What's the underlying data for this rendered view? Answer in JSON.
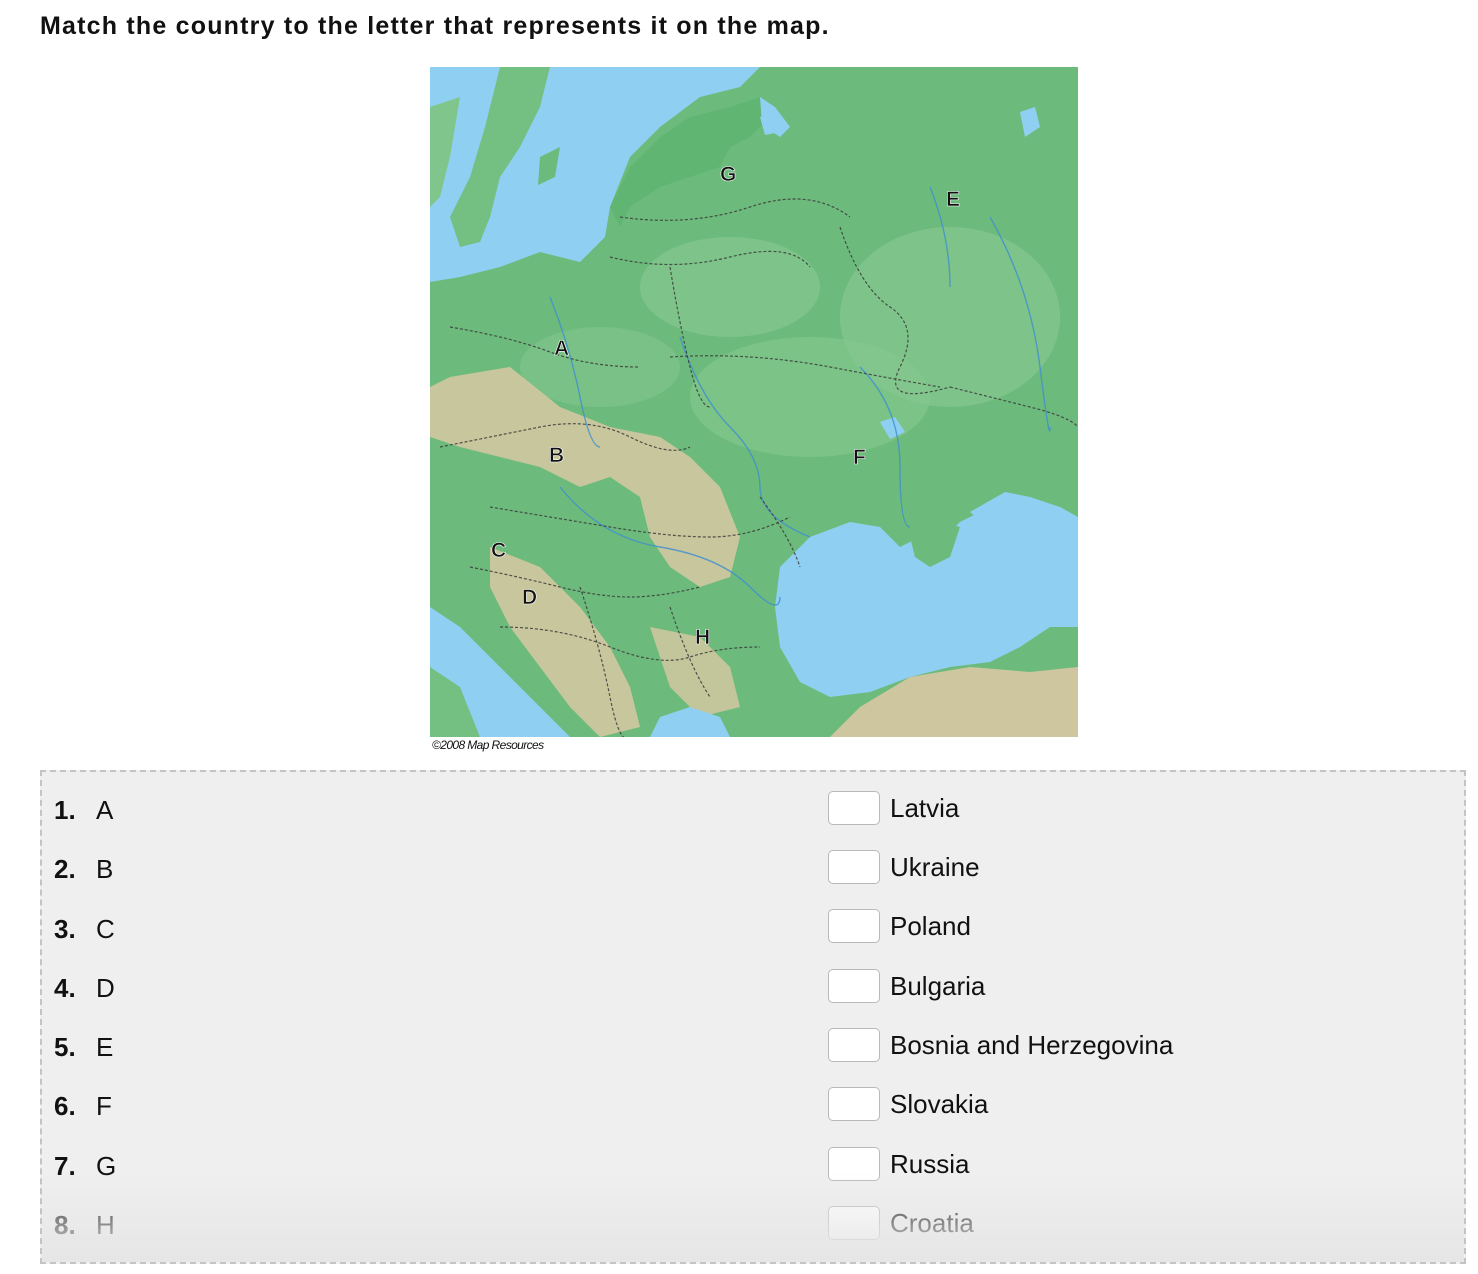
{
  "prompt": "Match the country to the letter that represents it on the map.",
  "map": {
    "credit": "©2008 Map Resources",
    "labels": [
      "A",
      "B",
      "C",
      "D",
      "E",
      "F",
      "G",
      "H"
    ],
    "colors": {
      "water": "#8fd0f2",
      "land_dark": "#5db36e",
      "land": "#72bd80",
      "land_light": "#8ccb95",
      "mountain": "#d9c9a6",
      "border": "#3b3b3b"
    }
  },
  "left_items": [
    {
      "num": "1.",
      "letter": "A"
    },
    {
      "num": "2.",
      "letter": "B"
    },
    {
      "num": "3.",
      "letter": "C"
    },
    {
      "num": "4.",
      "letter": "D"
    },
    {
      "num": "5.",
      "letter": "E"
    },
    {
      "num": "6.",
      "letter": "F"
    },
    {
      "num": "7.",
      "letter": "G"
    },
    {
      "num": "8.",
      "letter": "H"
    }
  ],
  "right_items": [
    {
      "country": "Latvia",
      "answer": ""
    },
    {
      "country": "Ukraine",
      "answer": ""
    },
    {
      "country": "Poland",
      "answer": ""
    },
    {
      "country": "Bulgaria",
      "answer": ""
    },
    {
      "country": "Bosnia and Herzegovina",
      "answer": ""
    },
    {
      "country": "Slovakia",
      "answer": ""
    },
    {
      "country": "Russia",
      "answer": ""
    },
    {
      "country": "Croatia",
      "answer": ""
    }
  ]
}
